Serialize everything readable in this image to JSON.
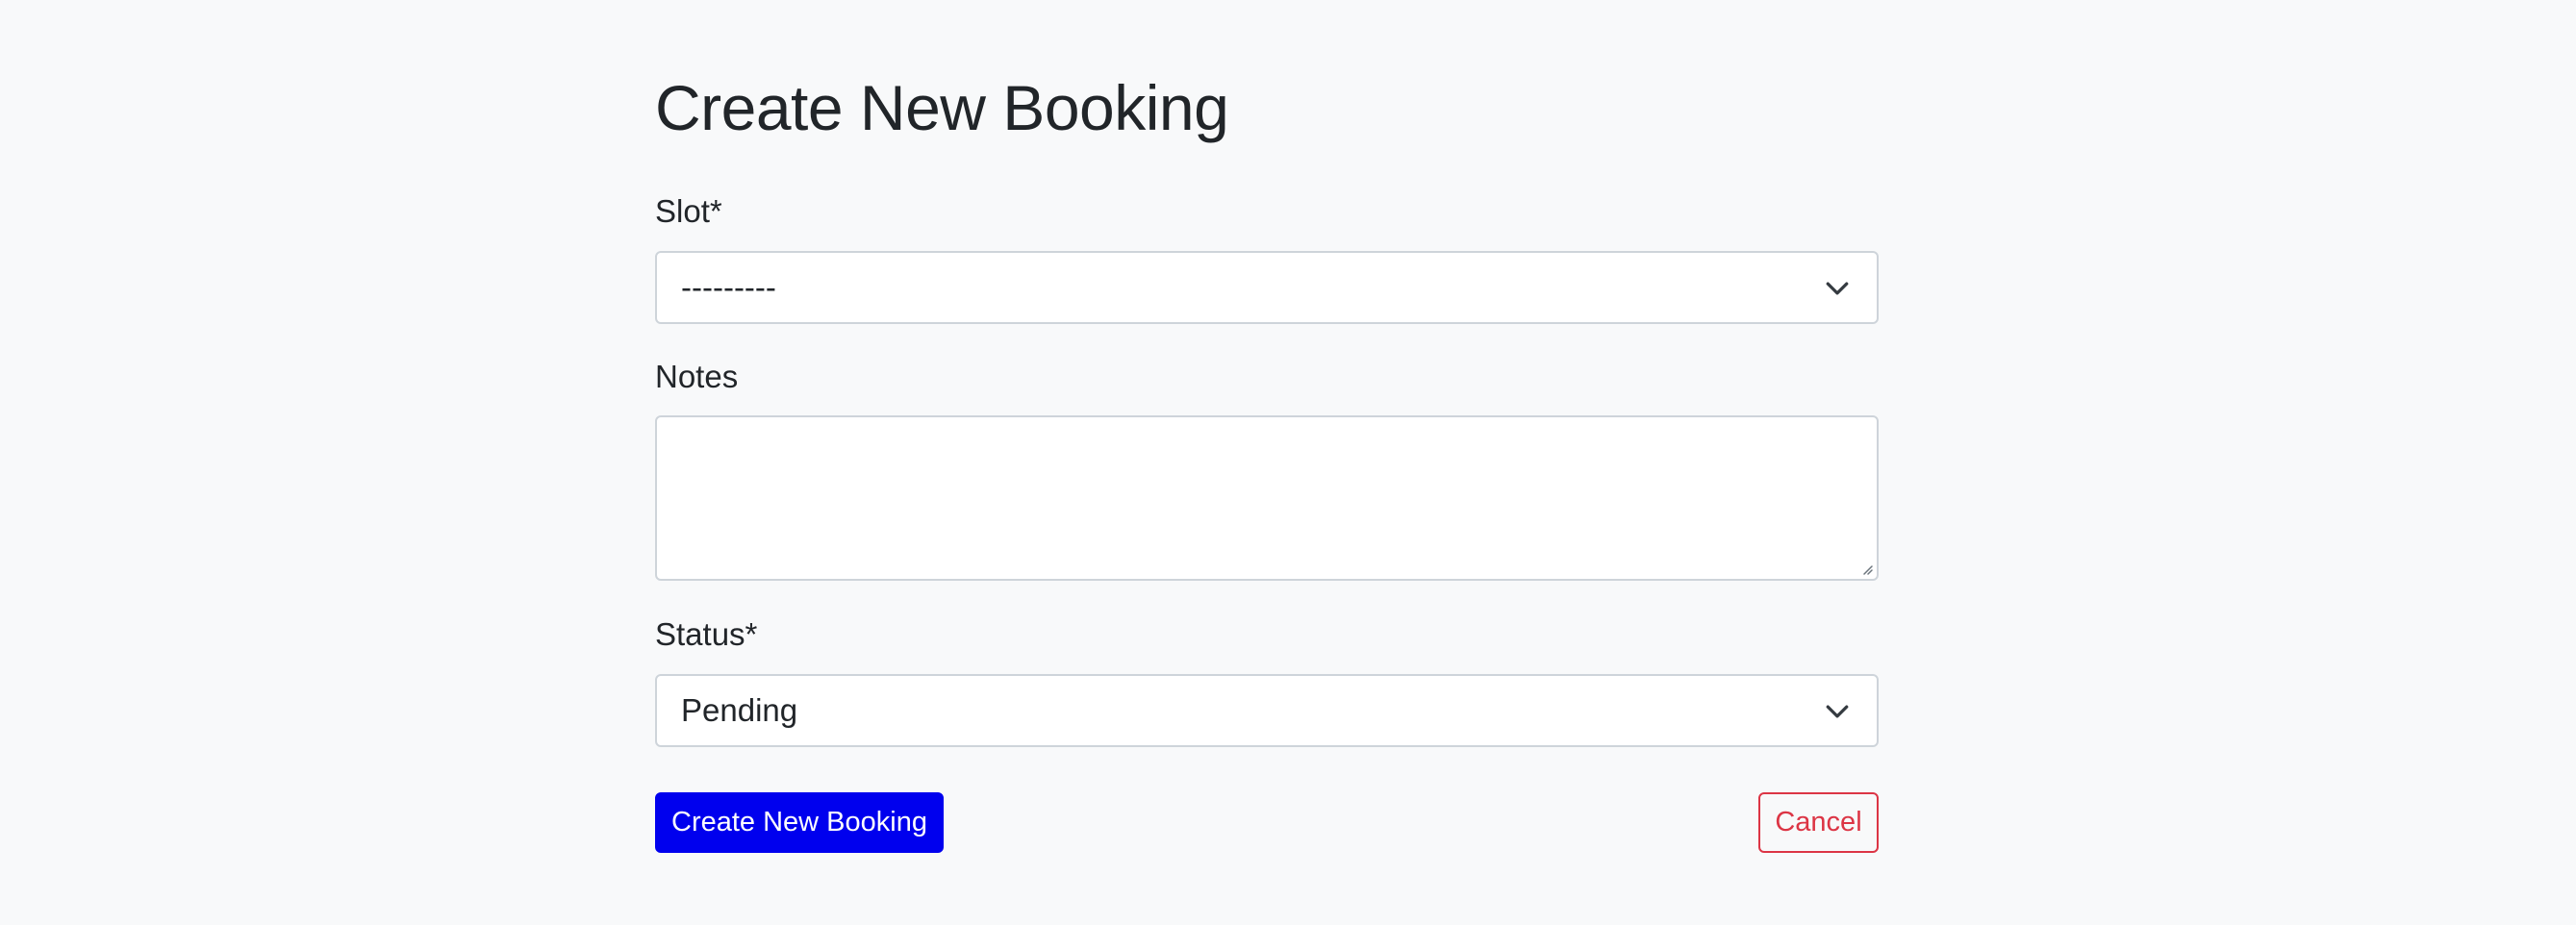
{
  "page": {
    "title": "Create New Booking"
  },
  "form": {
    "slot": {
      "label": "Slot*",
      "selected": "---------"
    },
    "notes": {
      "label": "Notes",
      "value": ""
    },
    "status": {
      "label": "Status*",
      "selected": "Pending"
    }
  },
  "actions": {
    "submit_label": "Create New Booking",
    "cancel_label": "Cancel"
  },
  "colors": {
    "background": "#f8f9fa",
    "primary": "#0000ee",
    "danger": "#dc3545",
    "border": "#ced4da",
    "text": "#212529"
  },
  "icons": {
    "select_arrow": "chevron-down-icon",
    "textarea_resize": "resize-handle-icon"
  }
}
